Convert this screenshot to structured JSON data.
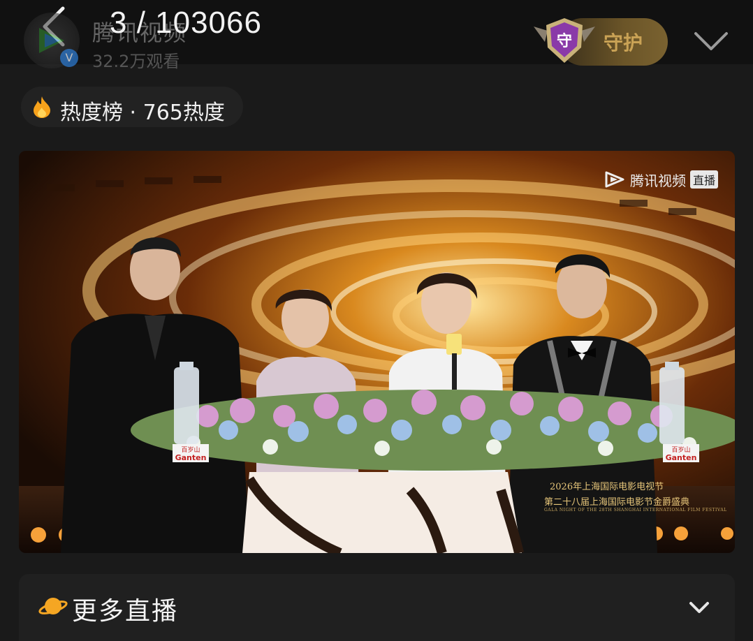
{
  "header": {
    "page_counter": "3 / 103066",
    "channel_name": "腾讯视频",
    "views": "32.2万观看",
    "avatar_badge": "V",
    "guard_label": "守护",
    "guard_shield_char": "守"
  },
  "hot": {
    "text": "热度榜 · 765热度"
  },
  "video": {
    "watermark_text": "腾讯视频",
    "watermark_live": "直播",
    "caption_line1": "2026年上海国际电影电视节",
    "caption_line2": "第二十八届上海国际电影节金爵盛典",
    "caption_line3": "GALA NIGHT OF THE 28TH SHANGHAI INTERNATIONAL FILM FESTIVAL",
    "bottle_label_top": "百岁山",
    "bottle_label_brand": "Ganten"
  },
  "more_live": {
    "label": "更多直播"
  },
  "colors": {
    "background": "#1a1a1a",
    "header": "#111111",
    "gold": "#c9a255",
    "fire": "#f7a21b"
  }
}
